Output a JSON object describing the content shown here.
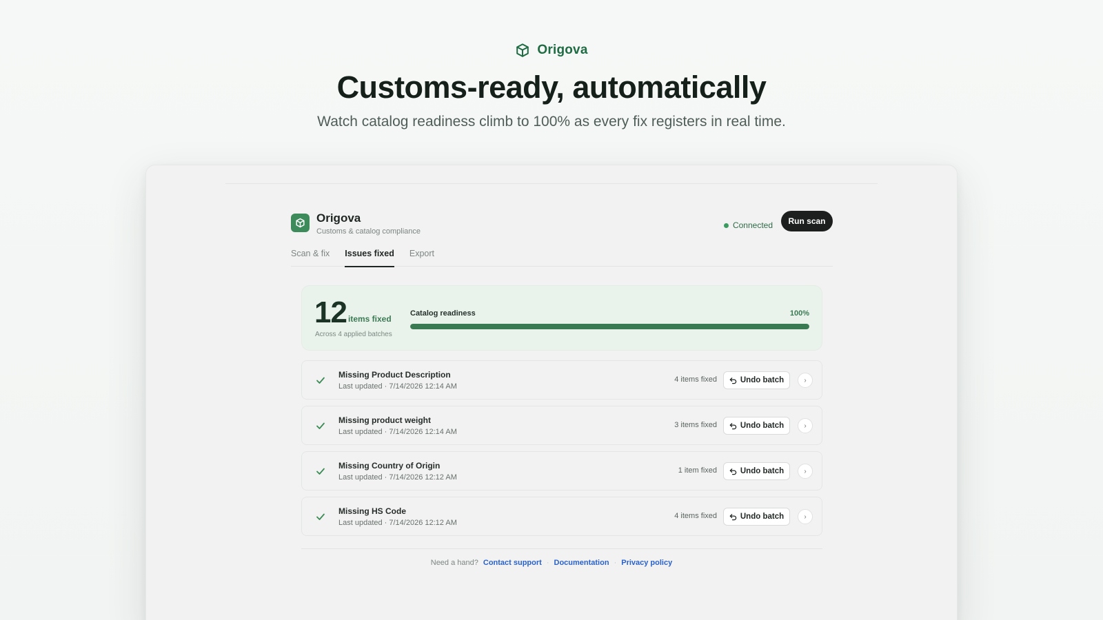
{
  "hero": {
    "brand": "Origova",
    "title": "Customs-ready, automatically",
    "subtitle": "Watch catalog readiness climb to 100% as every fix registers in real time."
  },
  "app": {
    "name": "Origova",
    "tagline": "Customs & catalog compliance",
    "status": "Connected",
    "run_scan_label": "Run scan"
  },
  "tabs": [
    {
      "label": "Scan & fix",
      "active": false
    },
    {
      "label": "Issues fixed",
      "active": true
    },
    {
      "label": "Export",
      "active": false
    }
  ],
  "summary": {
    "count": "12",
    "count_label": "items fixed",
    "count_sub": "Across 4 applied batches",
    "readiness_label": "Catalog readiness",
    "readiness_value": "100%",
    "readiness_fraction": 1.0
  },
  "issues": [
    {
      "title": "Missing Product Description",
      "updated": "Last updated · 7/14/2026 12:14 AM",
      "count": "4 items fixed",
      "undo_label": "Undo batch"
    },
    {
      "title": "Missing product weight",
      "updated": "Last updated · 7/14/2026 12:14 AM",
      "count": "3 items fixed",
      "undo_label": "Undo batch"
    },
    {
      "title": "Missing Country of Origin",
      "updated": "Last updated · 7/14/2026 12:12 AM",
      "count": "1 item fixed",
      "undo_label": "Undo batch"
    },
    {
      "title": "Missing HS Code",
      "updated": "Last updated · 7/14/2026 12:12 AM",
      "count": "4 items fixed",
      "undo_label": "Undo batch"
    }
  ],
  "footer": {
    "prompt": "Need a hand?",
    "links": [
      "Contact support",
      "Documentation",
      "Privacy policy"
    ]
  },
  "colors": {
    "brand": "#1f6b43",
    "accent": "#3a7a52",
    "link": "#2a62c9"
  }
}
